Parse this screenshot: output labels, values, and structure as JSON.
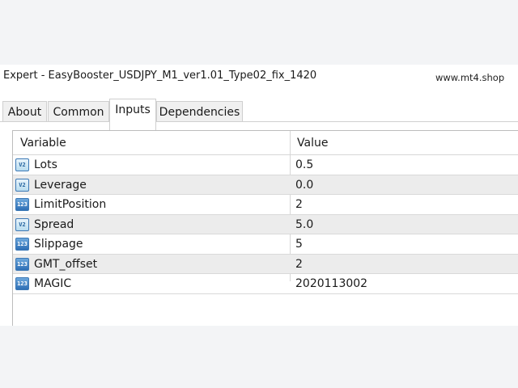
{
  "window": {
    "title": "Expert - EasyBooster_USDJPY_M1_ver1.01_Type02_fix_1420",
    "watermark": "www.mt4.shop"
  },
  "tabs": [
    {
      "label": "About",
      "active": false
    },
    {
      "label": "Common",
      "active": false
    },
    {
      "label": "Inputs",
      "active": true
    },
    {
      "label": "Dependencies",
      "active": false
    }
  ],
  "grid": {
    "headers": {
      "variable": "Variable",
      "value": "Value"
    },
    "rows": [
      {
        "icon": "double-type-icon",
        "icon_text": "V2",
        "name": "Lots",
        "value": "0.5"
      },
      {
        "icon": "double-type-icon",
        "icon_text": "V2",
        "name": "Leverage",
        "value": "0.0"
      },
      {
        "icon": "integer-type-icon",
        "icon_text": "123",
        "name": "LimitPosition",
        "value": "2"
      },
      {
        "icon": "double-type-icon",
        "icon_text": "V2",
        "name": "Spread",
        "value": "5.0"
      },
      {
        "icon": "integer-type-icon",
        "icon_text": "123",
        "name": "Slippage",
        "value": "5"
      },
      {
        "icon": "integer-type-icon",
        "icon_text": "123",
        "name": "GMT_offset",
        "value": "2"
      },
      {
        "icon": "integer-type-icon",
        "icon_text": "123",
        "name": "MAGIC",
        "value": "2020113002"
      }
    ]
  }
}
